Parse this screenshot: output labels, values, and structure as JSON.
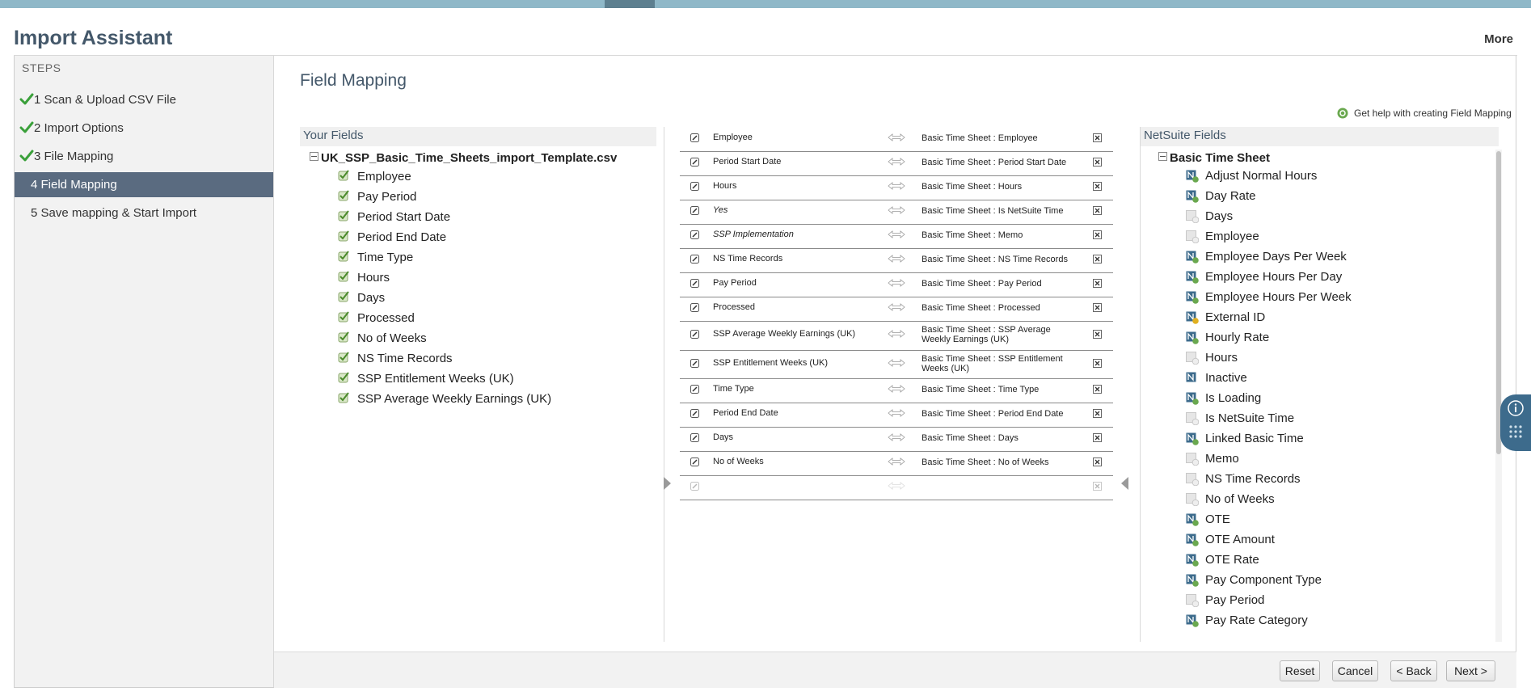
{
  "app": {
    "title": "Import Assistant",
    "more_label": "More"
  },
  "steps": {
    "heading": "STEPS",
    "items": [
      {
        "label": "1 Scan & Upload CSV File",
        "state": "complete"
      },
      {
        "label": "2 Import Options",
        "state": "complete"
      },
      {
        "label": "3 File Mapping",
        "state": "complete"
      },
      {
        "label": "4 Field Mapping",
        "state": "active"
      },
      {
        "label": "5 Save mapping & Start Import",
        "state": "pending"
      }
    ]
  },
  "main": {
    "title": "Field Mapping",
    "help_label": "Get help with creating Field Mapping"
  },
  "your_fields": {
    "heading": "Your Fields",
    "file_name": "UK_SSP_Basic_Time_Sheets_import_Template.csv",
    "items": [
      "Employee",
      "Pay Period",
      "Period Start Date",
      "Period End Date",
      "Time Type",
      "Hours",
      "Days",
      "Processed",
      "No of Weeks",
      "NS Time Records",
      "SSP Entitlement Weeks (UK)",
      "SSP Average Weekly Earnings (UK)"
    ]
  },
  "mappings": [
    {
      "source": "Employee",
      "italic": false,
      "target": "Basic Time Sheet : Employee"
    },
    {
      "source": "Period Start Date",
      "italic": false,
      "target": "Basic Time Sheet : Period Start Date"
    },
    {
      "source": "Hours",
      "italic": false,
      "target": "Basic Time Sheet : Hours"
    },
    {
      "source": "Yes",
      "italic": true,
      "target": "Basic Time Sheet : Is NetSuite Time"
    },
    {
      "source": "SSP Implementation",
      "italic": true,
      "target": "Basic Time Sheet : Memo"
    },
    {
      "source": "NS Time Records",
      "italic": false,
      "target": "Basic Time Sheet : NS Time Records"
    },
    {
      "source": "Pay Period",
      "italic": false,
      "target": "Basic Time Sheet : Pay Period"
    },
    {
      "source": "Processed",
      "italic": false,
      "target": "Basic Time Sheet : Processed"
    },
    {
      "source": "SSP Average Weekly Earnings (UK)",
      "italic": false,
      "target": "Basic Time Sheet : SSP Average Weekly Earnings (UK)"
    },
    {
      "source": "SSP Entitlement Weeks (UK)",
      "italic": false,
      "target": "Basic Time Sheet : SSP Entitlement Weeks (UK)"
    },
    {
      "source": "Time Type",
      "italic": false,
      "target": "Basic Time Sheet : Time Type"
    },
    {
      "source": "Period End Date",
      "italic": false,
      "target": "Basic Time Sheet : Period End Date"
    },
    {
      "source": "Days",
      "italic": false,
      "target": "Basic Time Sheet : Days"
    },
    {
      "source": "No of Weeks",
      "italic": false,
      "target": "Basic Time Sheet : No of Weeks"
    },
    {
      "source": "",
      "italic": false,
      "target": ""
    }
  ],
  "netsuite_fields": {
    "heading": "NetSuite Fields",
    "record": "Basic Time Sheet",
    "items": [
      {
        "label": "Adjust Normal Hours",
        "icon": "ns-mapped-icon"
      },
      {
        "label": "Day Rate",
        "icon": "ns-mapped-icon"
      },
      {
        "label": "Days",
        "icon": "ns-used-icon"
      },
      {
        "label": "Employee",
        "icon": "ns-used-icon"
      },
      {
        "label": "Employee Days Per Week",
        "icon": "ns-mapped-icon"
      },
      {
        "label": "Employee Hours Per Day",
        "icon": "ns-mapped-icon"
      },
      {
        "label": "Employee Hours Per Week",
        "icon": "ns-mapped-icon"
      },
      {
        "label": "External ID",
        "icon": "ns-key-icon"
      },
      {
        "label": "Hourly Rate",
        "icon": "ns-mapped-icon"
      },
      {
        "label": "Hours",
        "icon": "ns-used-icon"
      },
      {
        "label": "Inactive",
        "icon": "ns-field-icon"
      },
      {
        "label": "Is Loading",
        "icon": "ns-mapped-icon"
      },
      {
        "label": "Is NetSuite Time",
        "icon": "ns-used-icon"
      },
      {
        "label": "Linked Basic Time",
        "icon": "ns-mapped-icon"
      },
      {
        "label": "Memo",
        "icon": "ns-used-icon"
      },
      {
        "label": "NS Time Records",
        "icon": "ns-used-icon"
      },
      {
        "label": "No of Weeks",
        "icon": "ns-used-icon"
      },
      {
        "label": "OTE",
        "icon": "ns-mapped-icon"
      },
      {
        "label": "OTE Amount",
        "icon": "ns-mapped-icon"
      },
      {
        "label": "OTE Rate",
        "icon": "ns-mapped-icon"
      },
      {
        "label": "Pay Component Type",
        "icon": "ns-mapped-icon"
      },
      {
        "label": "Pay Period",
        "icon": "ns-used-icon"
      },
      {
        "label": "Pay Rate Category",
        "icon": "ns-mapped-icon"
      }
    ]
  },
  "footer": {
    "reset_label": "Reset",
    "cancel_label": "Cancel",
    "back_label": "< Back",
    "next_label": "Next >"
  },
  "colors": {
    "active_step": "#5a6b80",
    "check_green": "#3aa03a",
    "title": "#44586a"
  }
}
